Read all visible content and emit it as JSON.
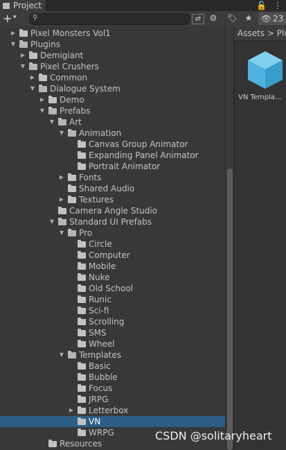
{
  "window": {
    "tab_label": "Project",
    "lock_icon": "lock-icon",
    "menu_icon": "kebab-menu-icon"
  },
  "toolbar": {
    "create_label": "+",
    "create_caret": "▾",
    "search_placeholder": "",
    "hidden_count": "23"
  },
  "breadcrumb": {
    "items": [
      "Assets",
      "Plu"
    ],
    "separator": ">"
  },
  "asset": {
    "label": "VN Templa..."
  },
  "tree": [
    {
      "label": "Pixel Monsters Vol1",
      "depth": 1,
      "arrow": "right",
      "open": false,
      "selected": false
    },
    {
      "label": "Plugins",
      "depth": 1,
      "arrow": "down",
      "open": true,
      "selected": false
    },
    {
      "label": "Demigiant",
      "depth": 2,
      "arrow": "right",
      "open": false,
      "selected": false
    },
    {
      "label": "Pixel Crushers",
      "depth": 2,
      "arrow": "down",
      "open": true,
      "selected": false
    },
    {
      "label": "Common",
      "depth": 3,
      "arrow": "right",
      "open": false,
      "selected": false
    },
    {
      "label": "Dialogue System",
      "depth": 3,
      "arrow": "down",
      "open": true,
      "selected": false
    },
    {
      "label": "Demo",
      "depth": 4,
      "arrow": "right",
      "open": false,
      "selected": false
    },
    {
      "label": "Prefabs",
      "depth": 4,
      "arrow": "down",
      "open": true,
      "selected": false
    },
    {
      "label": "Art",
      "depth": 5,
      "arrow": "down",
      "open": true,
      "selected": false
    },
    {
      "label": "Animation",
      "depth": 6,
      "arrow": "down",
      "open": true,
      "selected": false
    },
    {
      "label": "Canvas Group Animator",
      "depth": 7,
      "arrow": "",
      "open": false,
      "selected": false
    },
    {
      "label": "Expanding Panel Animator",
      "depth": 7,
      "arrow": "",
      "open": false,
      "selected": false
    },
    {
      "label": "Portrait Animator",
      "depth": 7,
      "arrow": "",
      "open": false,
      "selected": false
    },
    {
      "label": "Fonts",
      "depth": 6,
      "arrow": "right",
      "open": false,
      "selected": false
    },
    {
      "label": "Shared Audio",
      "depth": 6,
      "arrow": "",
      "open": false,
      "selected": false
    },
    {
      "label": "Textures",
      "depth": 6,
      "arrow": "right",
      "open": false,
      "selected": false
    },
    {
      "label": "Camera Angle Studio",
      "depth": 5,
      "arrow": "",
      "open": false,
      "selected": false
    },
    {
      "label": "Standard UI Prefabs",
      "depth": 5,
      "arrow": "down",
      "open": true,
      "selected": false
    },
    {
      "label": "Pro",
      "depth": 6,
      "arrow": "down",
      "open": true,
      "selected": false
    },
    {
      "label": "Circle",
      "depth": 7,
      "arrow": "",
      "open": false,
      "selected": false
    },
    {
      "label": "Computer",
      "depth": 7,
      "arrow": "",
      "open": false,
      "selected": false
    },
    {
      "label": "Mobile",
      "depth": 7,
      "arrow": "",
      "open": false,
      "selected": false
    },
    {
      "label": "Nuke",
      "depth": 7,
      "arrow": "",
      "open": false,
      "selected": false
    },
    {
      "label": "Old School",
      "depth": 7,
      "arrow": "",
      "open": false,
      "selected": false
    },
    {
      "label": "Runic",
      "depth": 7,
      "arrow": "",
      "open": false,
      "selected": false
    },
    {
      "label": "Sci-fi",
      "depth": 7,
      "arrow": "",
      "open": false,
      "selected": false
    },
    {
      "label": "Scrolling",
      "depth": 7,
      "arrow": "",
      "open": false,
      "selected": false
    },
    {
      "label": "SMS",
      "depth": 7,
      "arrow": "",
      "open": false,
      "selected": false
    },
    {
      "label": "Wheel",
      "depth": 7,
      "arrow": "",
      "open": false,
      "selected": false
    },
    {
      "label": "Templates",
      "depth": 6,
      "arrow": "down",
      "open": true,
      "selected": false
    },
    {
      "label": "Basic",
      "depth": 7,
      "arrow": "",
      "open": false,
      "selected": false
    },
    {
      "label": "Bubble",
      "depth": 7,
      "arrow": "",
      "open": false,
      "selected": false
    },
    {
      "label": "Focus",
      "depth": 7,
      "arrow": "",
      "open": false,
      "selected": false
    },
    {
      "label": "JRPG",
      "depth": 7,
      "arrow": "",
      "open": false,
      "selected": false
    },
    {
      "label": "Letterbox",
      "depth": 7,
      "arrow": "right",
      "open": false,
      "selected": false
    },
    {
      "label": "VN",
      "depth": 7,
      "arrow": "",
      "open": false,
      "selected": true
    },
    {
      "label": "WRPG",
      "depth": 7,
      "arrow": "",
      "open": false,
      "selected": false
    },
    {
      "label": "Resources",
      "depth": 4,
      "arrow": "",
      "open": false,
      "selected": false
    }
  ],
  "watermark": "CSDN @solitaryheart",
  "colors": {
    "selection": "#2c5d87",
    "panel_bg": "#383838",
    "folder": "#c2c2c2"
  }
}
